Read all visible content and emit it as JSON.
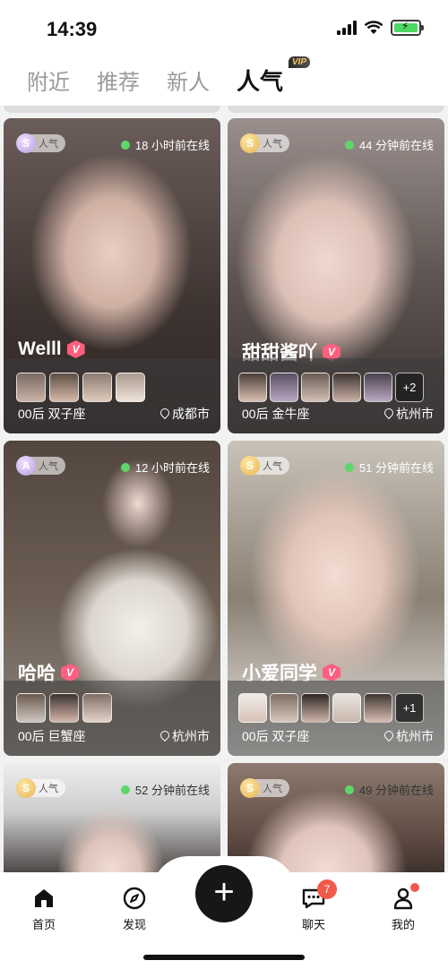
{
  "status_bar": {
    "time": "14:39"
  },
  "top_tabs": [
    {
      "label": "附近",
      "active": false
    },
    {
      "label": "推荐",
      "active": false
    },
    {
      "label": "新人",
      "active": false
    },
    {
      "label": "人气",
      "active": true,
      "badge": "VIP"
    }
  ],
  "cards": [
    {
      "badge_coin": "S",
      "badge_label": "人气",
      "online": "18 小时前在线",
      "name": "Welll",
      "verify": "V",
      "more": "",
      "meta": "00后 双子座",
      "city": "成都市"
    },
    {
      "badge_coin": "S",
      "badge_label": "人气",
      "online": "44 分钟前在线",
      "name": "甜甜酱吖",
      "verify": "V",
      "more": "+2",
      "meta": "00后 金牛座",
      "city": "杭州市"
    },
    {
      "badge_coin": "A",
      "badge_label": "人气",
      "online": "12 小时前在线",
      "name": "哈哈",
      "verify": "V",
      "more": "",
      "meta": "00后 巨蟹座",
      "city": "杭州市"
    },
    {
      "badge_coin": "S",
      "badge_label": "人气",
      "online": "51 分钟前在线",
      "name": "小爱同学",
      "verify": "V",
      "more": "+1",
      "meta": "00后 双子座",
      "city": "杭州市"
    },
    {
      "badge_coin": "S",
      "badge_label": "人气",
      "online": "52 分钟前在线"
    },
    {
      "badge_coin": "S",
      "badge_label": "人气",
      "online": "49 分钟前在线"
    }
  ],
  "bottom_nav": {
    "home": "首页",
    "discover": "发现",
    "plus": "+",
    "chat": "聊天",
    "chat_badge": "7",
    "me": "我的"
  },
  "colors": {
    "online_dot": "#5fd66b",
    "verify": "#ff5f7e",
    "badge_red": "#f15a4a"
  }
}
